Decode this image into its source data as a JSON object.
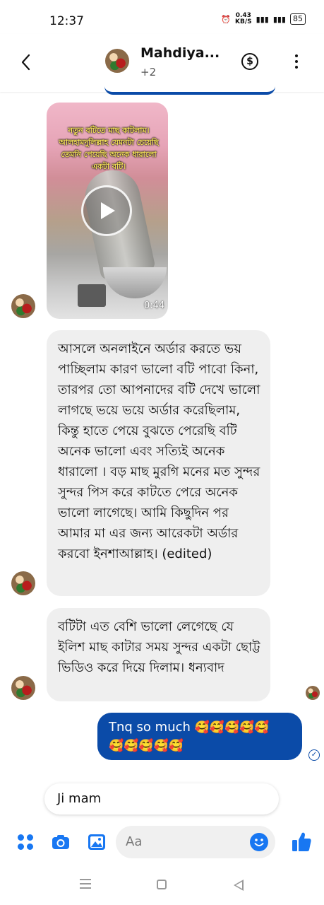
{
  "status": {
    "time": "12:37",
    "net_speed": "0.43\nKB/S",
    "battery": "85"
  },
  "header": {
    "name": "Mahdiya...",
    "subtitle": "+2"
  },
  "video": {
    "caption": "নতুন বটিতে মাছ কাটলাম। আলহামদুলিল্লাহ যেমনটা চেয়েছি তেমনি পেয়েছি অনেক ধারালো একটা বটি।",
    "duration": "0:44"
  },
  "messages": {
    "incoming_1": "আসলে অনলাইনে অর্ডার করতে ভয় পাচ্ছিলাম কারণ ভালো বটি পাবো কিনা, তারপর তো আপনাদের বটি  দেখে ভালো লাগছে ভয়ে ভয়ে অর্ডার করেছিলাম, কিন্তু হাতে পেয়ে বুঝতে পেরেছি বটি অনেক ভালো এবং সত্যিই অনেক ধারালো । বড় মাছ মুরগি মনের মত  সুন্দর সুন্দর পিস করে কাটতে পেরে অনেক ভালো লাগেছে। আমি কিছুদিন পর আমার মা এর জন্য আরেকটা অর্ডার করবো ইনশাআল্লাহ।",
    "incoming_1_edited": "(edited)",
    "incoming_2": "বটিটা এত বেশি ভালো লেগেছে যে ইলিশ মাছ কাটার সময়  সুন্দর একটা ছোট্ট ভিডিও করে দিয়ে দিলাম। ধন্যবাদ",
    "outgoing_text": "Tnq so much",
    "outgoing_emojis_line1": "🥰🥰🥰🥰🥰",
    "outgoing_emojis_line2": "🥰🥰🥰🥰🥰"
  },
  "suggestion": {
    "reply": "Ji mam"
  },
  "composer": {
    "placeholder": "Aa"
  },
  "icons": {
    "back": "chevron-left-icon",
    "payment": "dollar-circle-icon",
    "more": "more-vertical-icon",
    "apps": "grid-dots-icon",
    "camera": "camera-icon",
    "gallery": "image-icon",
    "emoji": "smiley-icon",
    "like": "thumbs-up-icon"
  },
  "colors": {
    "accent": "#1877f2",
    "outgoing_bubble": "#0b4ba8",
    "incoming_bubble": "#efefef"
  }
}
